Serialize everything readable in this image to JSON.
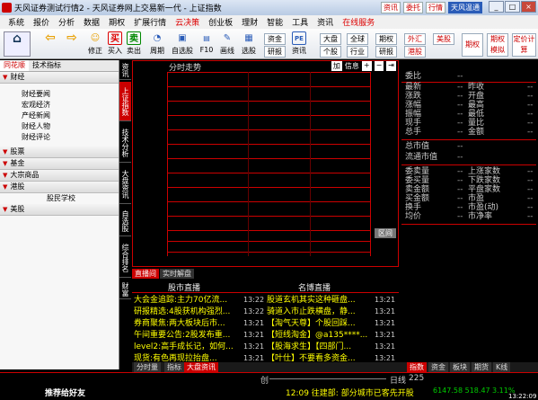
{
  "titlebar": {
    "title": "天风证券测试行情2 - 天风证券网上交易新一代 - 上证指数",
    "right_btns": [
      "资讯",
      "委托",
      "行情",
      "天风温通"
    ]
  },
  "menu": [
    "系统",
    "报价",
    "分析",
    "数据",
    "期权",
    "扩展行情",
    "云决策",
    "创业板",
    "理财",
    "智能",
    "工具",
    "资讯",
    "在线服务"
  ],
  "menu_red": [
    "云决策",
    "在线服务"
  ],
  "toolbar": {
    "buttons": [
      {
        "label": "修正",
        "icon": "☺"
      },
      {
        "label": "买入",
        "icon": "买"
      },
      {
        "label": "卖出",
        "icon": "卖"
      },
      {
        "label": "周期",
        "icon": "◔"
      },
      {
        "label": "自选股",
        "icon": "▣"
      },
      {
        "label": "F10",
        "icon": "F10"
      },
      {
        "label": "画线",
        "icon": "✎"
      },
      {
        "label": "选股",
        "icon": "▦"
      },
      {
        "label": "资讯",
        "icon": "PE"
      }
    ],
    "small_btns": [
      "资金",
      "研报",
      "大盘",
      "个股",
      "全球",
      "行业",
      "期权",
      "研报",
      "外汇",
      "港股",
      "美股"
    ],
    "big_btns": [
      "期权",
      "期权模拟",
      "在线交易",
      "定价计算"
    ]
  },
  "leftpanel": {
    "tabs": [
      "同花顺",
      "技术指标"
    ],
    "categories": [
      {
        "name": "财经",
        "items": [
          "财经要闻",
          "宏观经济",
          "产经新闻",
          "财经人物",
          "财经评论"
        ]
      },
      {
        "name": "股票",
        "items": []
      },
      {
        "name": "基金",
        "items": []
      },
      {
        "name": "大宗商品",
        "items": []
      },
      {
        "name": "港股",
        "items": [
          "股民学校"
        ]
      },
      {
        "name": "美股",
        "items": []
      }
    ]
  },
  "vtabs": [
    "资讯",
    "上证指数",
    "技术分析",
    "大盘资讯",
    "自选股",
    "综合排名",
    "财富"
  ],
  "chart": {
    "label": "分时走势",
    "controls": [
      "加",
      "信息",
      "+",
      "−",
      "⇥"
    ],
    "side_label": "区间"
  },
  "rightpanel": {
    "title": "委比",
    "rows1": [
      [
        "最新",
        "--",
        "昨收",
        "--"
      ],
      [
        "涨跌",
        "--",
        "开盘",
        "--"
      ],
      [
        "涨幅",
        "--",
        "最高",
        "--"
      ],
      [
        "振幅",
        "--",
        "最低",
        "--"
      ],
      [
        "现手",
        "--",
        "量比",
        "--"
      ],
      [
        "总手",
        "--",
        "金额",
        "--"
      ]
    ],
    "rows2": [
      [
        "总市值",
        "--"
      ],
      [
        "流通市值",
        "--"
      ]
    ],
    "rows3": [
      [
        "委卖量",
        "--",
        "上涨家数",
        "--"
      ],
      [
        "委买量",
        "--",
        "下跌家数",
        "--"
      ],
      [
        "卖金额",
        "--",
        "平盘家数",
        "--"
      ],
      [
        "买金额",
        "--",
        "市盈",
        "--"
      ],
      [
        "换手",
        "--",
        "市盈(动)",
        "--"
      ],
      [
        "均价",
        "--",
        "市净率",
        "--"
      ]
    ]
  },
  "news": {
    "tabs": [
      "直播间",
      "实时解盘"
    ],
    "col1_header": "股市直播",
    "col2_header": "名博直播",
    "left": [
      [
        "大会金追踪:主力70亿流...",
        "13:22"
      ],
      [
        "研报精选:4股获机构强烈...",
        "13:22"
      ],
      [
        "券商聚焦:两大板块后市...",
        "13:21"
      ],
      [
        "午间重要公告:2股发布重...",
        "13:21"
      ],
      [
        "level2:高手成长记，如何...",
        "13:21"
      ],
      [
        "现货:有色再现拉抬盘...",
        "13:21"
      ]
    ],
    "right": [
      [
        "股道玄机其实这种砸盘...",
        "13:21"
      ],
      [
        "骑道入市止跌横盘，静...",
        "13:21"
      ],
      [
        "【淘气天尊】个股回踩...",
        "13:21"
      ],
      [
        "【短线淘金】@a135****...",
        "13:21"
      ],
      [
        "【股海求生】【四部门...",
        "13:21"
      ],
      [
        "【叶仕】不要看多资金...",
        "13:21"
      ]
    ]
  },
  "bottomtabs": {
    "left": [
      "分时量",
      "指标",
      "大盘资讯"
    ],
    "right": [
      "指数",
      "资金",
      "板块",
      "期货",
      "K线"
    ]
  },
  "status": {
    "index_label": "创",
    "right_label": "日线",
    "value": "225",
    "recommend": "推荐给好友",
    "ticker": "12:09 往建部: 部分城市已客先开股",
    "quote": "6147.58 518.47",
    "pct": "3.11%",
    "time": "13:22:09"
  }
}
